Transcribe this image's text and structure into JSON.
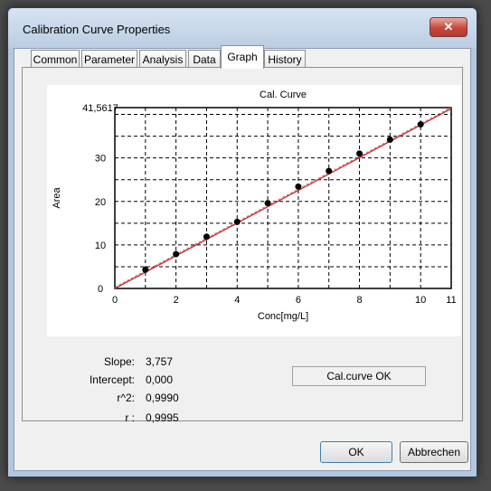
{
  "window": {
    "title": "Calibration Curve Properties",
    "close_symbol": "✕"
  },
  "tabs": [
    {
      "label": "Common"
    },
    {
      "label": "Parameter"
    },
    {
      "label": "Analysis"
    },
    {
      "label": "Data"
    },
    {
      "label": "Graph"
    },
    {
      "label": "History"
    }
  ],
  "active_tab": "Graph",
  "results": {
    "slope_label": "Slope:",
    "slope_value": "3,757",
    "intercept_label": "Intercept:",
    "intercept_value": "0,000",
    "r2_label": "r^2:",
    "r2_value": "0,9990",
    "r_label": "r :",
    "r_value": "0,9995",
    "status": "Cal.curve OK"
  },
  "buttons": {
    "ok": "OK",
    "cancel": "Abbrechen"
  },
  "colors": {
    "fit_line": "#d42020",
    "points": "#000000"
  },
  "chart_data": {
    "type": "scatter",
    "title": "Cal. Curve",
    "xlabel": "Conc[mg/L]",
    "ylabel": "Area",
    "xlim": [
      0,
      11
    ],
    "ylim": [
      0,
      41.5617
    ],
    "x_ticks": [
      0,
      2,
      4,
      6,
      8,
      10,
      11
    ],
    "x_tick_labels": [
      "0",
      "2",
      "4",
      "6",
      "8",
      "10",
      "11"
    ],
    "y_ticks": [
      0,
      10,
      20,
      30,
      41.5617
    ],
    "y_tick_labels": [
      "0",
      "10",
      "20",
      "30",
      "41,5617"
    ],
    "grid": true,
    "series": [
      {
        "x": [
          1,
          2,
          3,
          4,
          5,
          6,
          7,
          8,
          9,
          10
        ],
        "y": [
          4.3,
          7.9,
          11.9,
          15.3,
          19.6,
          23.4,
          27.0,
          31.0,
          34.2,
          37.7
        ]
      }
    ],
    "fit": {
      "slope": 3.757,
      "intercept": 0.0
    }
  }
}
